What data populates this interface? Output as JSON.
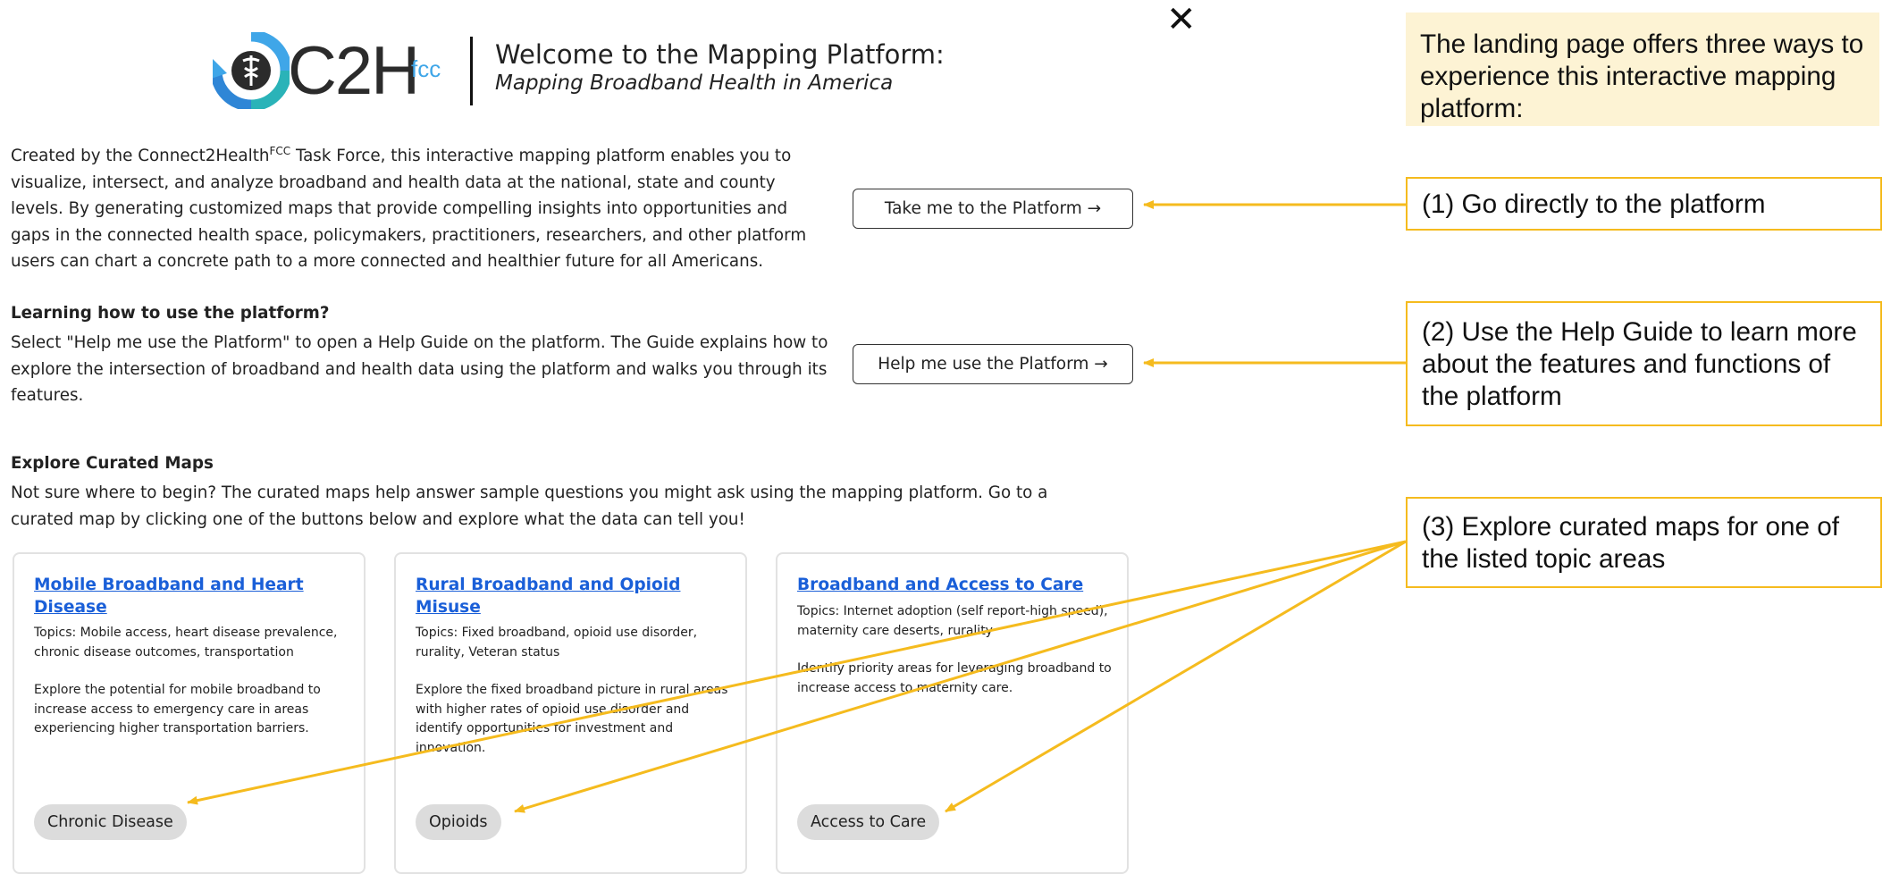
{
  "header": {
    "logo_text": "C2H",
    "logo_suffix": "fcc",
    "title": "Welcome to the Mapping Platform:",
    "subtitle": "Mapping Broadband Health in America",
    "close_icon": "close-x-icon"
  },
  "intro": {
    "text_before": "Created by the Connect2Health",
    "superscript": "FCC",
    "text_after": " Task Force, this interactive mapping platform enables you to visualize, intersect, and analyze broadband and health data at the national, state and county levels. By generating customized maps that provide compelling insights into opportunities and gaps in the connected health space, policymakers, practitioners, researchers, and other platform users can chart a concrete path to a more connected and healthier future for all Americans."
  },
  "learn": {
    "heading": "Learning how to use the platform?",
    "text": "Select \"Help me use the Platform\" to open a Help Guide on the platform. The Guide explains how to explore the intersection of broadband and health data using the platform and walks you through its features."
  },
  "explore": {
    "heading": "Explore Curated Maps",
    "text": "Not sure where to begin? The curated maps help answer sample questions you might ask using the mapping platform. Go to a curated map by clicking one of the buttons below and explore what the data can tell you!"
  },
  "buttons": {
    "take": "Take me to the Platform →",
    "help": "Help me use the Platform →"
  },
  "cards": [
    {
      "title": "Mobile Broadband and Heart Disease",
      "topics": "Topics: Mobile access, heart disease prevalence, chronic disease outcomes, transportation",
      "description": "Explore the potential for mobile broadband to increase access to emergency care in areas experiencing higher transportation barriers.",
      "tag": "Chronic Disease"
    },
    {
      "title": "Rural Broadband and Opioid Misuse",
      "topics": "Topics: Fixed broadband, opioid use disorder, rurality, Veteran status",
      "description": "Explore the fixed broadband picture in rural areas with higher rates of opioid use disorder and identify opportunities for investment and innovation.",
      "tag": "Opioids"
    },
    {
      "title": "Broadband and Access to Care",
      "topics": "Topics: Internet adoption (self report-high speed), maternity care deserts, rurality",
      "description": "Identify priority areas for leveraging broadband to increase access to maternity care.",
      "tag": "Access to Care"
    }
  ],
  "annotations": {
    "intro": "The landing page offers three ways to experience this interactive mapping platform:",
    "note1": "(1) Go directly to the platform",
    "note2": "(2) Use the Help Guide to learn more about the features and functions of the platform",
    "note3": "(3) Explore curated maps for one of the listed topic areas"
  },
  "colors": {
    "annotation_accent": "#f5bb1e",
    "annotation_fill": "#fdf3d4",
    "link_blue": "#1a5fd8",
    "logo_blue": "#3fa6e8",
    "logo_teal": "#2ab3b8"
  }
}
